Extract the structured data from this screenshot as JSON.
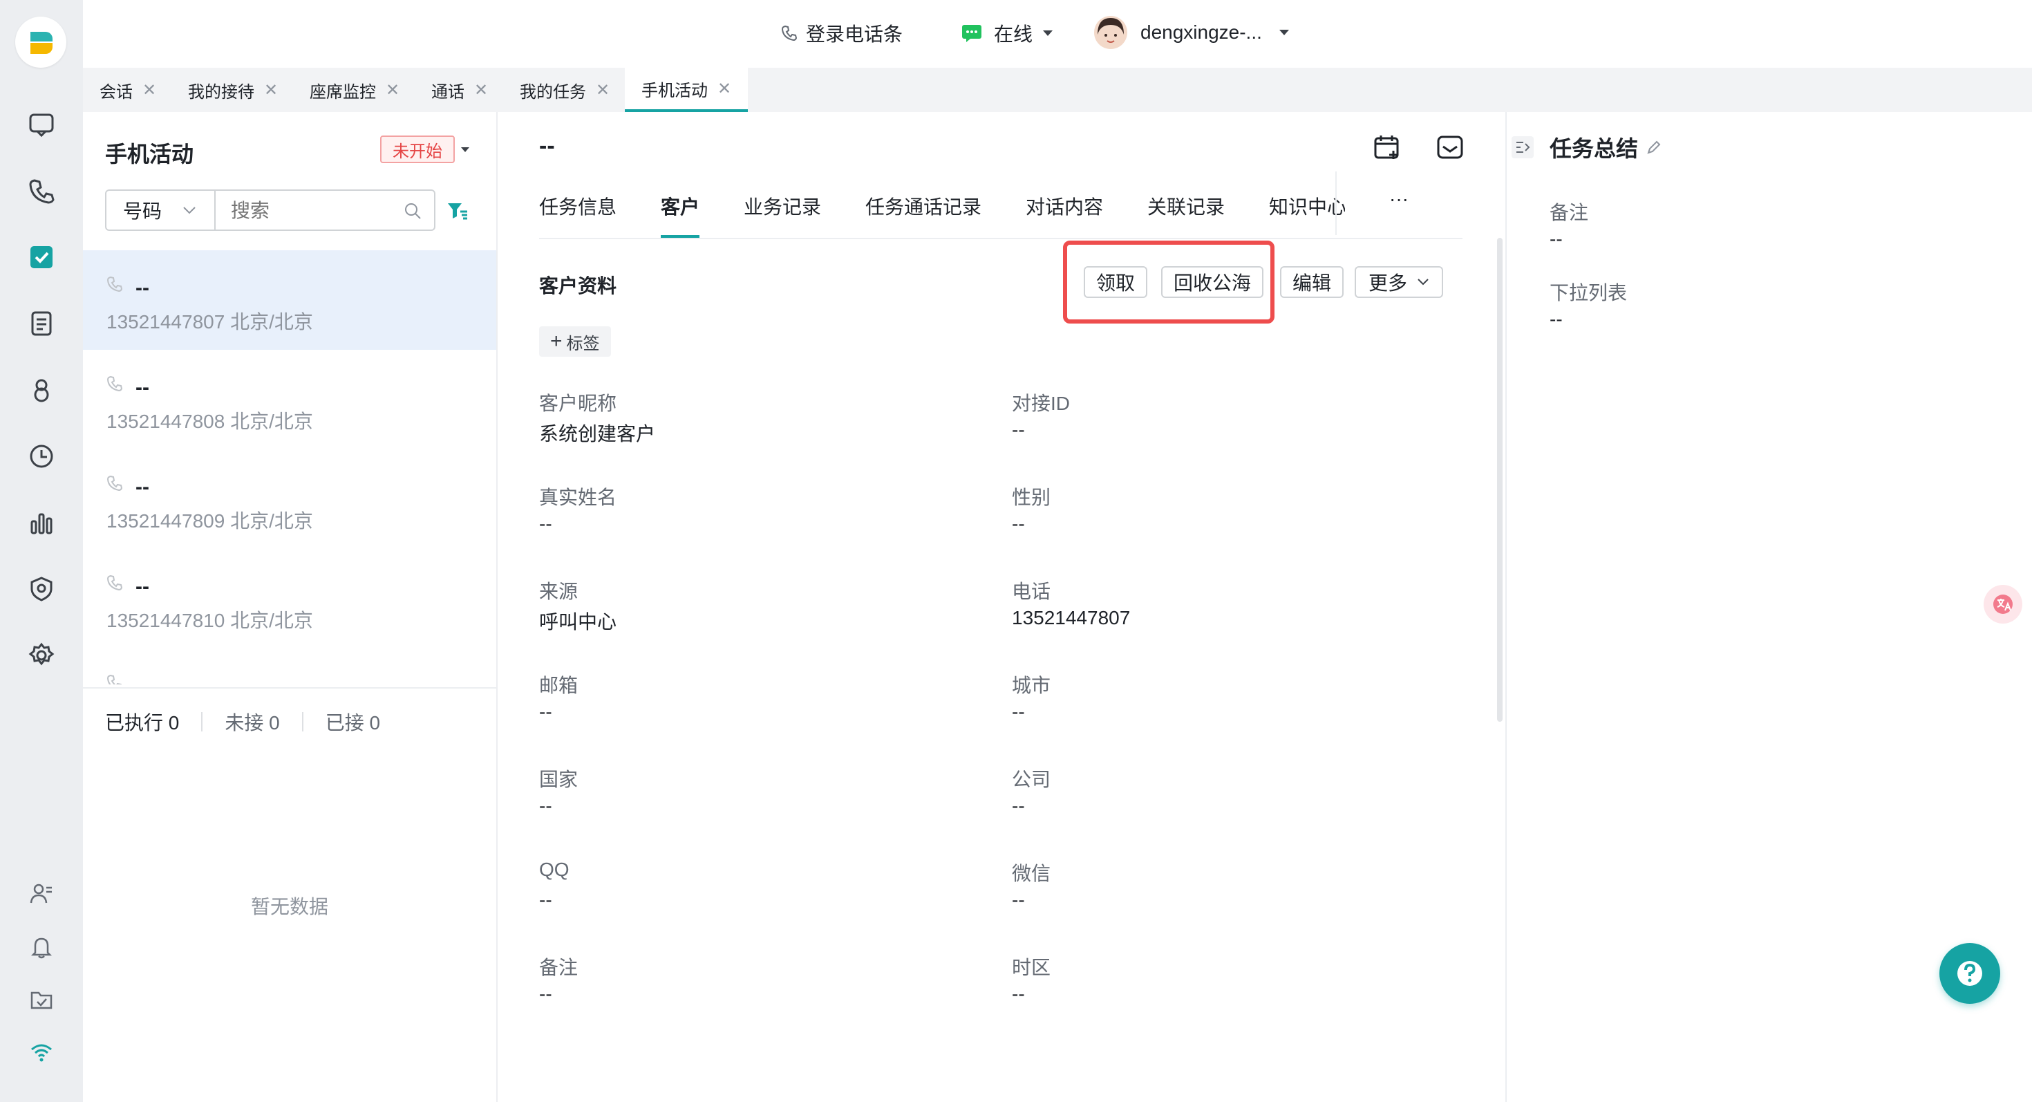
{
  "topbar": {
    "login_phone_label": "登录电话条",
    "status_label": "在线",
    "username": "dengxingze-..."
  },
  "page_tabs": [
    {
      "label": "会话"
    },
    {
      "label": "我的接待"
    },
    {
      "label": "座席监控"
    },
    {
      "label": "通话"
    },
    {
      "label": "我的任务"
    },
    {
      "label": "手机活动",
      "active": true
    }
  ],
  "list_panel": {
    "title": "手机活动",
    "status_badge": "未开始",
    "filter_select": "号码",
    "search_placeholder": "搜索",
    "items": [
      {
        "name": "--",
        "phone": "13521447807 北京/北京",
        "selected": true
      },
      {
        "name": "--",
        "phone": "13521447808 北京/北京"
      },
      {
        "name": "--",
        "phone": "13521447809 北京/北京"
      },
      {
        "name": "--",
        "phone": "13521447810 北京/北京"
      },
      {
        "name": "--",
        "phone": ""
      }
    ],
    "stats": {
      "executed": "已执行 0",
      "missed": "未接 0",
      "answered": "已接 0"
    },
    "empty_text": "暂无数据"
  },
  "detail": {
    "title": "--",
    "tabs": [
      "任务信息",
      "客户",
      "业务记录",
      "任务通话记录",
      "对话内容",
      "关联记录",
      "知识中心",
      "···"
    ],
    "active_tab": 1,
    "section_title": "客户资料",
    "buttons": {
      "claim": "领取",
      "recycle": "回收公海",
      "edit": "编辑",
      "more": "更多"
    },
    "tag_button": "标签",
    "fields": [
      {
        "label": "客户昵称",
        "value": "系统创建客户"
      },
      {
        "label": "对接ID",
        "value": "--"
      },
      {
        "label": "真实姓名",
        "value": "--"
      },
      {
        "label": "性别",
        "value": "--"
      },
      {
        "label": "来源",
        "value": "呼叫中心"
      },
      {
        "label": "电话",
        "value": "13521447807"
      },
      {
        "label": "邮箱",
        "value": "--"
      },
      {
        "label": "城市",
        "value": "--"
      },
      {
        "label": "国家",
        "value": "--"
      },
      {
        "label": "公司",
        "value": "--"
      },
      {
        "label": "QQ",
        "value": "--"
      },
      {
        "label": "微信",
        "value": "--"
      },
      {
        "label": "备注",
        "value": "--"
      },
      {
        "label": "时区",
        "value": "--"
      }
    ]
  },
  "summary": {
    "title": "任务总结",
    "fields": [
      {
        "label": "备注",
        "value": "--"
      },
      {
        "label": "下拉列表",
        "value": "--"
      }
    ]
  },
  "colors": {
    "accent": "#16a3a3",
    "highlight_box": "#ee4d4d",
    "selected_bg": "#e8f0fb"
  }
}
